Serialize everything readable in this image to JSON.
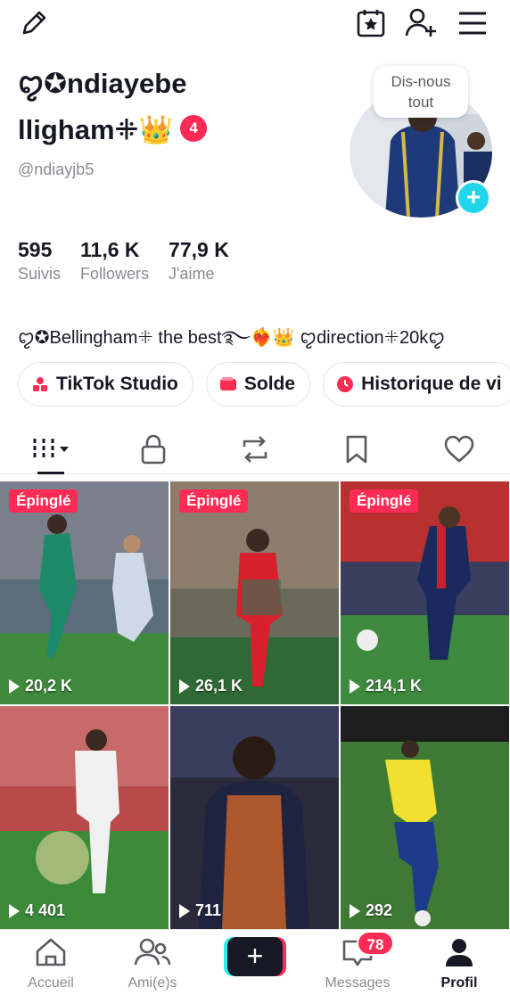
{
  "profile": {
    "name_line1": "ꨄ✪ndiayebe",
    "name_line2": "llighamꔰ",
    "crown": "👑",
    "badge_count": "4",
    "handle": "@ndiayjb5",
    "bubble_line1": "Dis-nous",
    "bubble_line2": "tout",
    "add_symbol": "+"
  },
  "stats": [
    {
      "value": "595",
      "label": "Suivis"
    },
    {
      "value": "11,6 K",
      "label": "Followers"
    },
    {
      "value": "77,9 K",
      "label": "J'aime"
    }
  ],
  "bio": "ꨄ✪Bellinghamꔰ the best࿐❤️‍🔥👑 ꨄdirectionꔰ20kꨄ",
  "chips": [
    {
      "label": "TikTok Studio"
    },
    {
      "label": "Solde"
    },
    {
      "label": "Historique de vi"
    }
  ],
  "pinned_label": "Épinglé",
  "videos": [
    {
      "views": "20,2 K",
      "pinned": true
    },
    {
      "views": "26,1 K",
      "pinned": true
    },
    {
      "views": "214,1 K",
      "pinned": true
    },
    {
      "views": "4 401",
      "pinned": false
    },
    {
      "views": "711",
      "pinned": false
    },
    {
      "views": "292",
      "pinned": false
    }
  ],
  "nav": {
    "home": "Accueil",
    "friends": "Ami(e)s",
    "create": "+",
    "messages": "Messages",
    "messages_badge": "78",
    "profile": "Profil"
  },
  "icons": {
    "edit": "pencil-icon",
    "calendar": "calendar-star-icon",
    "add_user": "add-user-icon",
    "menu": "hamburger-menu-icon"
  },
  "colors": {
    "accent": "#fe2c55",
    "cyan": "#20d5ec"
  }
}
